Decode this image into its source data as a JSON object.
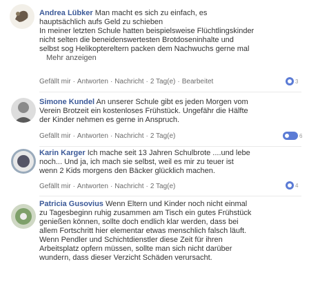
{
  "comments": [
    {
      "author": "Andrea Lübker",
      "text_lines": [
        " Man macht es sich zu einfach, es",
        "hauptsächlich aufs Geld zu schieben",
        "In meiner letzten Schule hatten beispielsweise Flüchtlingskinder",
        "nicht selten die beneidenswertesten Brotdoseninhalte und",
        "selbst sog Helikoptereltern packen dem Nachwuchs gerne mal"
      ],
      "more_label": "Mehr anzeigen",
      "meta": [
        "Gefällt mir",
        "Antworten",
        "Nachricht",
        "2 Tag(e)",
        "Bearbeitet"
      ],
      "likes": "3"
    },
    {
      "author": "Simone Kundel",
      "text_lines": [
        " An unserer Schule gibt es jeden Morgen vom",
        "Verein Brotzeit ein kostenloses Frühstück. Ungefähr die Hälfte",
        "der Kinder nehmen es gerne in Anspruch."
      ],
      "meta": [
        "Gefällt mir",
        "Antworten",
        "Nachricht",
        "2 Tag(e)"
      ],
      "likes": "6"
    },
    {
      "author": "Karin Karger",
      "text_lines": [
        " Ich mache seit 13 Jahren Schulbrote ....und lebe",
        "noch... Und ja, ich mach sie selbst, weil es mir zu teuer ist",
        "wenn 2 Kids morgens den Bäcker glücklich machen."
      ],
      "meta": [
        "Gefällt mir",
        "Antworten",
        "Nachricht",
        "2 Tag(e)"
      ],
      "likes": "4"
    },
    {
      "author": "Patricia Gusovius",
      "text_lines": [
        " Wenn Eltern und Kinder noch nicht einmal",
        "zu Tagesbeginn ruhig zusammen am Tisch ein gutes Frühstück",
        "genießen können, sollte doch endlich klar werden, dass bei",
        "allem Fortschritt hier elementar etwas menschlich falsch läuft.",
        "Wenn Pendler und Schichtdienstler diese Zeit für ihren",
        "Arbeitsplatz opfern müssen, sollte man sich nicht darüber",
        "wundern, dass dieser Verzicht Schäden verursacht."
      ]
    }
  ]
}
